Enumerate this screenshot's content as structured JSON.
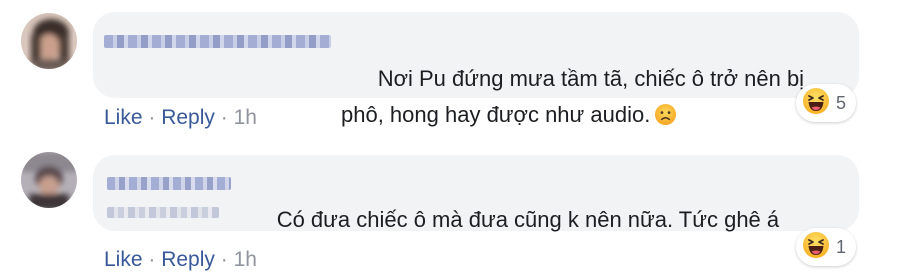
{
  "comments": [
    {
      "text": "Nơi Pu đứng mưa tầm tã, chiếc ô trở nên bị phô, hong hay được như audio.",
      "inline_emoji": "frowning-face",
      "actions": {
        "like": "Like",
        "sep1": " · ",
        "reply": "Reply",
        "sep2": " · ",
        "time": "1h"
      },
      "reaction": {
        "icon": "haha-emoji",
        "count": "5"
      }
    },
    {
      "text": "Có đưa chiếc ô mà đưa cũng k nên nữa. Tức ghê á",
      "actions": {
        "like": "Like",
        "sep1": " · ",
        "reply": "Reply",
        "sep2": " · ",
        "time": "1h"
      },
      "reaction": {
        "icon": "haha-emoji",
        "count": "1"
      }
    }
  ],
  "colors": {
    "bubble": "#f2f3f5",
    "link": "#385898",
    "meta": "#90949c",
    "blurred_name": "#8a96c8"
  }
}
